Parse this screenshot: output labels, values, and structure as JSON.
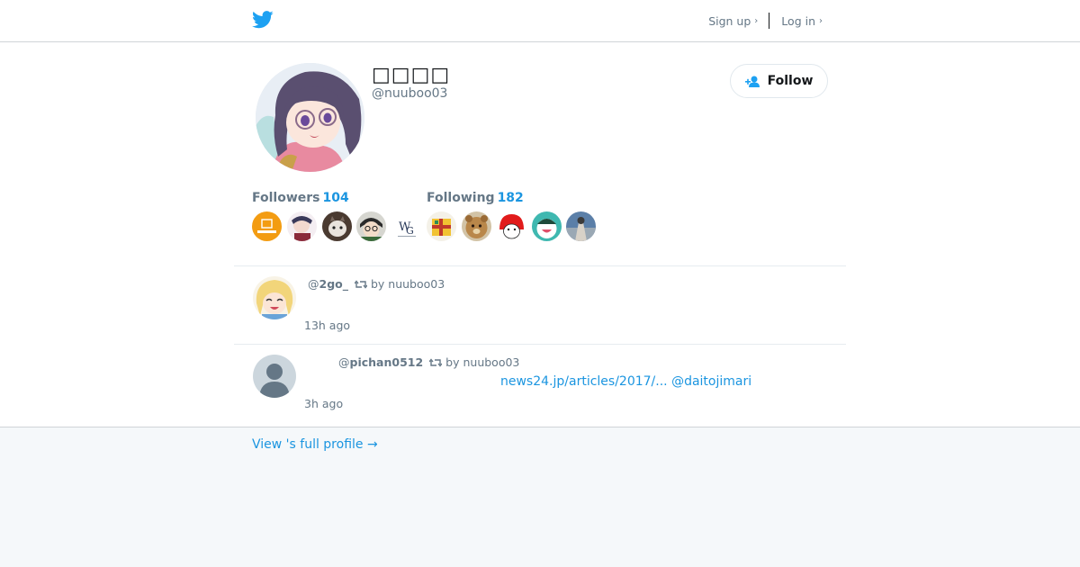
{
  "header": {
    "logo_icon": "twitter-bird-icon",
    "brand_color": "#1da1f2",
    "signup_label": "Sign up",
    "login_label": "Log in"
  },
  "profile": {
    "display_name": "□□□□",
    "handle": "@nuuboo03",
    "follow_label": "Follow",
    "followers_label": "Followers",
    "followers_count": "104",
    "following_label": "Following",
    "following_count": "182",
    "avatar_icon": "anime-glasses-avatar-image"
  },
  "followers_avatars": [
    {
      "icon": "orange-logo-avatar"
    },
    {
      "icon": "character-avatar"
    },
    {
      "icon": "cat-avatar"
    },
    {
      "icon": "glasses-character-avatar"
    },
    {
      "icon": "wg-logo-avatar"
    }
  ],
  "following_avatars": [
    {
      "icon": "yellow-box-avatar"
    },
    {
      "icon": "bear-avatar"
    },
    {
      "icon": "red-character-avatar"
    },
    {
      "icon": "teal-character-avatar"
    },
    {
      "icon": "photo-avatar"
    }
  ],
  "tweets": [
    {
      "author": "@2go_",
      "author_prefix": "@",
      "author_name": "2go_",
      "retweet_by": "by nuuboo03",
      "time": "13h ago",
      "avatar_icon": "blonde-anime-avatar"
    },
    {
      "author_prefix": "@",
      "author_name": "pichan0512",
      "retweet_by": "by nuuboo03",
      "time": "3h ago",
      "link_text": "news24.jp/articles/2017/...",
      "mention_text": "@daitojimari",
      "avatar_icon": "default-user-avatar"
    }
  ],
  "footer": {
    "view_profile_label": "View 's full profile →"
  },
  "colors": {
    "accent": "#1b95e0",
    "muted": "#657786",
    "background": "#f5f8fa"
  }
}
